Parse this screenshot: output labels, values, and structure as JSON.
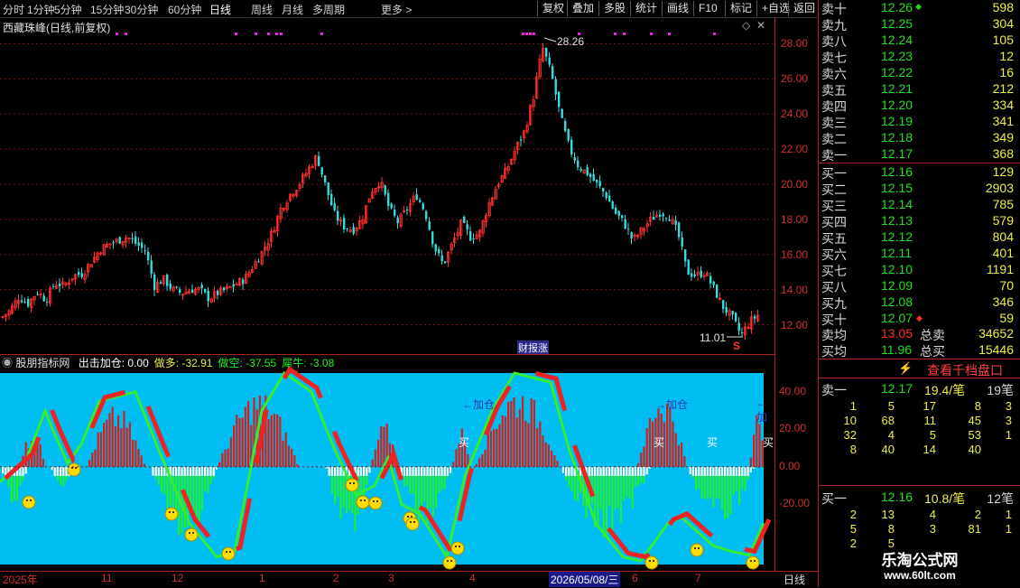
{
  "toolbar": {
    "left_items": [
      "分时",
      "1分钟",
      "5分钟",
      "15分钟",
      "30分钟",
      "60分钟",
      "日线",
      "周线",
      "月线",
      "多周期",
      "更多 >"
    ],
    "active_item": "日线",
    "right_items": [
      "复权",
      "叠加",
      "多股",
      "统计",
      "画线",
      "F10",
      "标记",
      "+自选",
      "返回"
    ]
  },
  "main_chart": {
    "title": "西藏珠峰(日线,前复权)",
    "high_label": "28.26",
    "low_label": "11.01",
    "marker_text": "财报涨",
    "s_marker": "S",
    "y_ticks": [
      "28.00",
      "26.00",
      "24.00",
      "22.00",
      "20.00",
      "18.00",
      "16.00",
      "14.00",
      "12.00"
    ]
  },
  "chart_data": {
    "type": "candlestick",
    "title": "西藏珠峰(日线,前复权)",
    "ylim": [
      11,
      29
    ],
    "close_path": [
      [
        0,
        12.4
      ],
      [
        10,
        12.8
      ],
      [
        20,
        13.6
      ],
      [
        30,
        13.2
      ],
      [
        40,
        13.9
      ],
      [
        50,
        13.4
      ],
      [
        60,
        14.4
      ],
      [
        70,
        14.2
      ],
      [
        80,
        14.8
      ],
      [
        90,
        14.9
      ],
      [
        100,
        15.6
      ],
      [
        110,
        16.3
      ],
      [
        120,
        16.6
      ],
      [
        130,
        16.8
      ],
      [
        140,
        17.0
      ],
      [
        150,
        16.6
      ],
      [
        160,
        16.2
      ],
      [
        170,
        14.2
      ],
      [
        180,
        14.6
      ],
      [
        190,
        14.0
      ],
      [
        200,
        13.8
      ],
      [
        210,
        14.0
      ],
      [
        220,
        14.0
      ],
      [
        230,
        13.5
      ],
      [
        240,
        13.8
      ],
      [
        250,
        14.0
      ],
      [
        260,
        14.3
      ],
      [
        270,
        14.6
      ],
      [
        280,
        15.4
      ],
      [
        290,
        16.2
      ],
      [
        300,
        17.2
      ],
      [
        310,
        18.6
      ],
      [
        320,
        19.4
      ],
      [
        330,
        20.0
      ],
      [
        340,
        20.8
      ],
      [
        350,
        21.6
      ],
      [
        360,
        19.8
      ],
      [
        370,
        18.2
      ],
      [
        380,
        17.6
      ],
      [
        390,
        17.4
      ],
      [
        400,
        18.0
      ],
      [
        410,
        19.6
      ],
      [
        420,
        20.2
      ],
      [
        430,
        18.6
      ],
      [
        440,
        17.8
      ],
      [
        450,
        18.6
      ],
      [
        460,
        19.4
      ],
      [
        470,
        18.4
      ],
      [
        480,
        16.4
      ],
      [
        490,
        15.4
      ],
      [
        500,
        16.6
      ],
      [
        510,
        17.8
      ],
      [
        520,
        17.0
      ],
      [
        530,
        17.2
      ],
      [
        540,
        18.8
      ],
      [
        550,
        20.0
      ],
      [
        560,
        20.8
      ],
      [
        570,
        22.0
      ],
      [
        580,
        23.0
      ],
      [
        590,
        25.0
      ],
      [
        600,
        27.8
      ],
      [
        610,
        26.2
      ],
      [
        620,
        23.8
      ],
      [
        630,
        22.0
      ],
      [
        640,
        21.0
      ],
      [
        650,
        20.6
      ],
      [
        660,
        20.0
      ],
      [
        670,
        19.4
      ],
      [
        680,
        18.4
      ],
      [
        690,
        17.8
      ],
      [
        700,
        16.8
      ],
      [
        710,
        17.4
      ],
      [
        720,
        18.0
      ],
      [
        730,
        18.4
      ],
      [
        740,
        18.2
      ],
      [
        750,
        17.2
      ],
      [
        760,
        15.0
      ],
      [
        770,
        14.8
      ],
      [
        780,
        15.0
      ],
      [
        790,
        14.0
      ],
      [
        800,
        13.0
      ],
      [
        810,
        12.4
      ],
      [
        820,
        11.4
      ],
      [
        830,
        12.2
      ],
      [
        840,
        12.6
      ]
    ]
  },
  "indicator": {
    "name": "股朋指标网",
    "series": [
      {
        "name": "出击加仓",
        "value": "0.00",
        "color": "#ffffff"
      },
      {
        "name": "做多",
        "value": "-32.91",
        "color": "#eeee44"
      },
      {
        "name": "做空",
        "value": "-37.55",
        "color": "#22ee22"
      },
      {
        "name": "犀牛",
        "value": "-3.08",
        "color": "#22ee22"
      }
    ],
    "y_ticks": [
      "40.00",
      "20.00",
      "0.00",
      "-20.00"
    ],
    "labels": {
      "add1": "←加仓",
      "add2": "→加仓",
      "add3": "←加",
      "buy": "买"
    }
  },
  "time_axis": {
    "labels": [
      "2025年",
      "11",
      "12",
      "1",
      "2",
      "3",
      "4",
      "2026/05/08/三",
      "6",
      "7"
    ],
    "period": "日线"
  },
  "orderbook": {
    "asks": [
      {
        "label": "卖十",
        "price": "12.26",
        "vol": "598"
      },
      {
        "label": "卖九",
        "price": "12.25",
        "vol": "304"
      },
      {
        "label": "卖八",
        "price": "12.24",
        "vol": "105"
      },
      {
        "label": "卖七",
        "price": "12.23",
        "vol": "12"
      },
      {
        "label": "卖六",
        "price": "12.22",
        "vol": "16"
      },
      {
        "label": "卖五",
        "price": "12.21",
        "vol": "212"
      },
      {
        "label": "卖四",
        "price": "12.20",
        "vol": "334"
      },
      {
        "label": "卖三",
        "price": "12.19",
        "vol": "341"
      },
      {
        "label": "卖二",
        "price": "12.18",
        "vol": "349"
      },
      {
        "label": "卖一",
        "price": "12.17",
        "vol": "368"
      }
    ],
    "bids": [
      {
        "label": "买一",
        "price": "12.16",
        "vol": "129"
      },
      {
        "label": "买二",
        "price": "12.15",
        "vol": "2903"
      },
      {
        "label": "买三",
        "price": "12.14",
        "vol": "785"
      },
      {
        "label": "买四",
        "price": "12.13",
        "vol": "579"
      },
      {
        "label": "买五",
        "price": "12.12",
        "vol": "804"
      },
      {
        "label": "买六",
        "price": "12.11",
        "vol": "401"
      },
      {
        "label": "买七",
        "price": "12.10",
        "vol": "1191"
      },
      {
        "label": "买八",
        "price": "12.09",
        "vol": "70"
      },
      {
        "label": "买九",
        "price": "12.08",
        "vol": "346"
      },
      {
        "label": "买十",
        "price": "12.07",
        "vol": "59"
      }
    ],
    "avg_sell": {
      "label": "卖均",
      "price": "13.05",
      "tlabel": "总卖",
      "total": "34652"
    },
    "avg_buy": {
      "label": "买均",
      "price": "11.96",
      "tlabel": "总买",
      "total": "15446"
    },
    "view_btn": "查看千档盘口",
    "sell1": {
      "label": "卖一",
      "price": "12.17",
      "per": "19.4/笔",
      "count": "19笔",
      "rows": [
        [
          "1",
          "5",
          "17",
          "8",
          "3"
        ],
        [
          "10",
          "68",
          "11",
          "45",
          "3"
        ],
        [
          "32",
          "4",
          "5",
          "53",
          "1"
        ],
        [
          "8",
          "40",
          "14",
          "40",
          ""
        ]
      ]
    },
    "buy1": {
      "label": "买一",
      "price": "12.16",
      "per": "10.8/笔",
      "count": "12笔",
      "rows": [
        [
          "2",
          "13",
          "4",
          "2",
          "1"
        ],
        [
          "5",
          "8",
          "3",
          "81",
          "1"
        ],
        [
          "2",
          "5",
          "",
          "",
          ""
        ]
      ]
    },
    "watermark": {
      "title": "乐淘公式网",
      "url": "www.60lt.com"
    }
  }
}
